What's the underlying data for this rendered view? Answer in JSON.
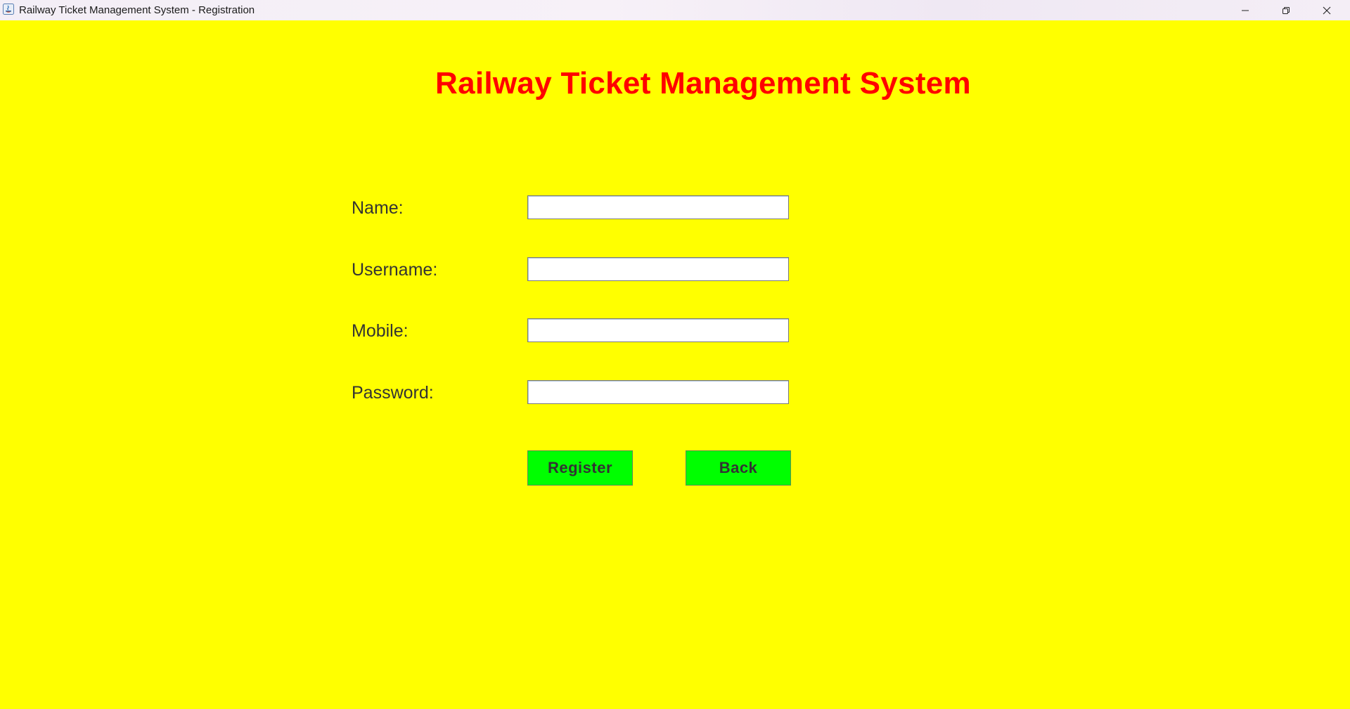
{
  "window": {
    "title": "Railway Ticket Management System - Registration",
    "icons": {
      "app": "java-app-icon",
      "minimize": "minimize-icon",
      "maximize": "restore-icon",
      "close": "close-icon"
    }
  },
  "page": {
    "heading": "Railway Ticket Management System",
    "background_color": "#ffff00",
    "heading_color": "#ff0000",
    "button_color": "#00ff00"
  },
  "form": {
    "name": {
      "label": "Name:",
      "value": ""
    },
    "username": {
      "label": "Username:",
      "value": ""
    },
    "mobile": {
      "label": "Mobile:",
      "value": ""
    },
    "password": {
      "label": "Password:",
      "value": ""
    }
  },
  "buttons": {
    "register_label": "Register",
    "back_label": "Back"
  }
}
